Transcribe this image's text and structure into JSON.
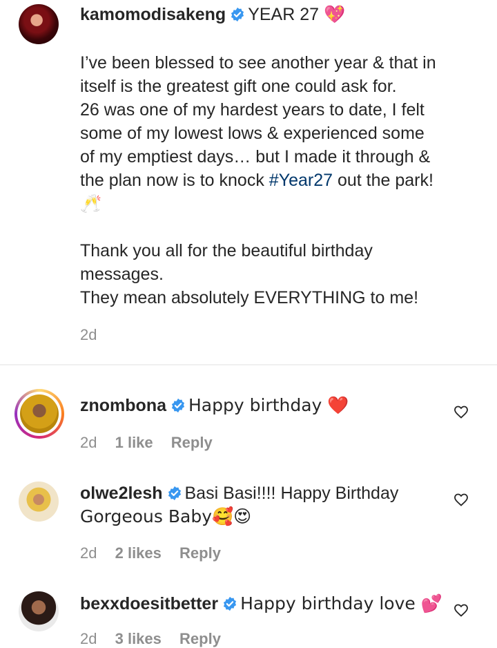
{
  "caption": {
    "username": "kamomodisakeng",
    "title": "YEAR 27 💖",
    "lines": [
      "I’ve been blessed to see another year & that in",
      "itself is the greatest gift one could ask for.",
      "26 was one of my hardest years to date, I felt",
      "some of my lowest lows & experienced some",
      "of my emptiest days… but I made it through &"
    ],
    "line6_before": "the plan now is to knock ",
    "hashtag": "#Year27",
    "line6_after": " out the park!",
    "emoji_line": "🥂",
    "lines2": [
      "Thank you all for the beautiful birthday",
      "messages.",
      "They mean absolutely EVERYTHING to me!"
    ],
    "time": "2d"
  },
  "comments": [
    {
      "username": "znombona",
      "text": "Happy birthday ❤️",
      "time": "2d",
      "likes": "1 like",
      "reply": "Reply"
    },
    {
      "username": "olwe2lesh",
      "text": "Basi Basi!!!! Happy Birthday",
      "text2": "Gorgeous Baby🥰😍",
      "time": "2d",
      "likes": "2 likes",
      "reply": "Reply"
    },
    {
      "username": "bexxdoesitbetter",
      "text": "Happy birthday love 💕",
      "time": "2d",
      "likes": "3 likes",
      "reply": "Reply"
    }
  ],
  "icons": {
    "verified": "verified-badge-icon",
    "like": "heart-outline-icon"
  },
  "colors": {
    "text": "#262626",
    "secondary": "#8e8e8e",
    "hashtag": "#00376b",
    "verified": "#3897f0"
  }
}
